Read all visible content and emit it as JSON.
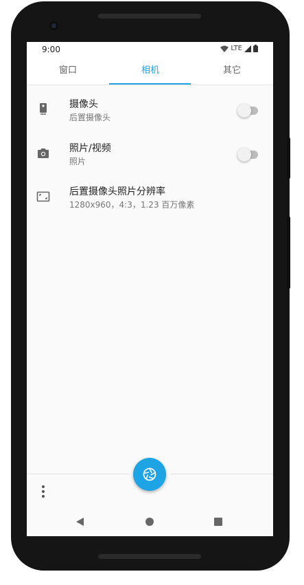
{
  "status_bar": {
    "time": "9:00",
    "network": "LTE"
  },
  "tabs": [
    {
      "label": "窗口",
      "active": false
    },
    {
      "label": "相机",
      "active": true
    },
    {
      "label": "其它",
      "active": false
    }
  ],
  "settings": [
    {
      "icon": "phone-camera-icon",
      "title": "摄像头",
      "subtitle": "后置摄像头",
      "has_switch": true,
      "switch_on": false
    },
    {
      "icon": "camera-icon",
      "title": "照片/视频",
      "subtitle": "照片",
      "has_switch": true,
      "switch_on": false
    },
    {
      "icon": "aspect-ratio-icon",
      "title": "后置摄像头照片分辨率",
      "subtitle": "1280x960，4:3，1.23 百万像素",
      "has_switch": false
    }
  ],
  "fab": {
    "icon": "shutter-icon"
  },
  "bottom_bar": {
    "menu_icon": "more-vert-icon"
  },
  "colors": {
    "accent": "#1ea3e4",
    "background": "#fafafa",
    "frame": "#151515"
  }
}
